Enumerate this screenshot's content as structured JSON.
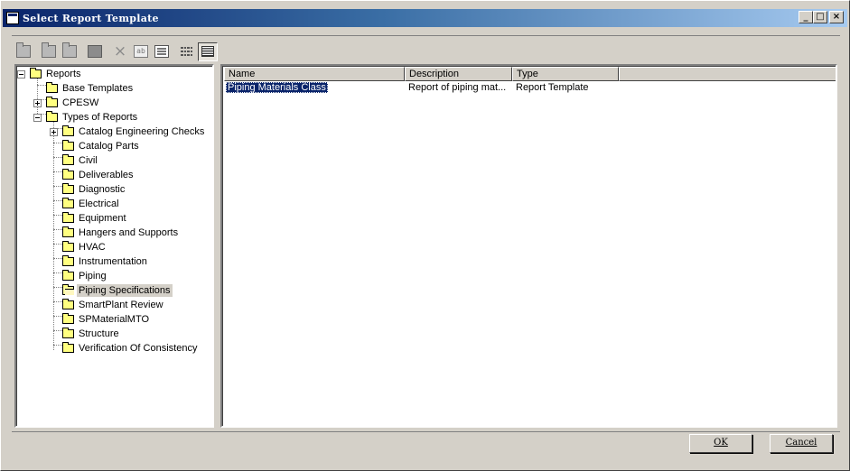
{
  "window": {
    "title": "Select Report Template",
    "controls": {
      "minimize": "_",
      "maximize": "□",
      "close": "×"
    }
  },
  "toolbar": {
    "buttons": [
      {
        "icon": "new-folder-icon"
      },
      {
        "icon": "new-item-icon"
      },
      {
        "icon": "copy-item-icon"
      },
      {
        "icon": "box-icon"
      },
      {
        "icon": "delete-icon"
      },
      {
        "icon": "rename-icon"
      },
      {
        "icon": "properties-icon"
      },
      {
        "icon": "list-view-icon"
      },
      {
        "icon": "details-view-icon",
        "active": true
      }
    ]
  },
  "tree": {
    "root": "Reports",
    "items": [
      {
        "label": "Base Templates"
      },
      {
        "label": "CPESW"
      },
      {
        "label": "Types of Reports"
      },
      {
        "label": "Catalog Engineering Checks"
      },
      {
        "label": "Catalog Parts"
      },
      {
        "label": "Civil"
      },
      {
        "label": "Deliverables"
      },
      {
        "label": "Diagnostic"
      },
      {
        "label": "Electrical"
      },
      {
        "label": "Equipment"
      },
      {
        "label": "Hangers and Supports"
      },
      {
        "label": "HVAC"
      },
      {
        "label": "Instrumentation"
      },
      {
        "label": "Piping"
      },
      {
        "label": "Piping Specifications",
        "selected": true
      },
      {
        "label": "SmartPlant Review"
      },
      {
        "label": "SPMaterialMTO"
      },
      {
        "label": "Structure"
      },
      {
        "label": "Verification Of Consistency"
      }
    ]
  },
  "list": {
    "columns": [
      "Name",
      "Description",
      "Type"
    ],
    "rows": [
      {
        "name": "Piping Materials Class",
        "description": "Report of piping mat...",
        "type": "Report Template"
      }
    ]
  },
  "buttons": {
    "ok": "OK",
    "cancel": "Cancel"
  },
  "colors": {
    "titlebar_start": "#0a246a",
    "titlebar_end": "#a6caf0",
    "selection": "#0a246a",
    "folder": "#ffff80",
    "face": "#d4d0c8"
  }
}
